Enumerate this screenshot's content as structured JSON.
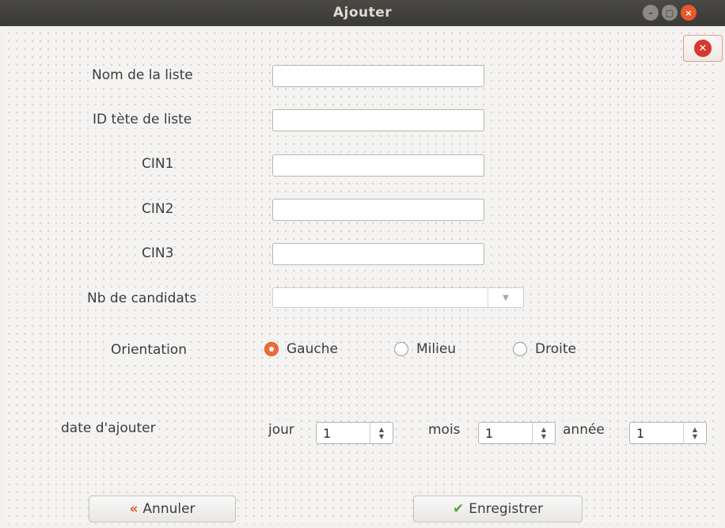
{
  "window": {
    "title": "Ajouter"
  },
  "form": {
    "nom_label": "Nom de la liste",
    "id_label": "ID tète de liste",
    "cin1_label": "CIN1",
    "cin2_label": "CIN2",
    "cin3_label": "CIN3",
    "nb_label": "Nb de candidats",
    "nom_value": "",
    "id_value": "",
    "cin1_value": "",
    "cin2_value": "",
    "cin3_value": "",
    "nb_selected": ""
  },
  "orientation": {
    "label": "Orientation",
    "options": [
      "Gauche",
      "Milieu",
      "Droite"
    ],
    "selected": "Gauche"
  },
  "date": {
    "label": "date d'ajouter",
    "jour_label": "jour",
    "jour_value": "1",
    "mois_label": "mois",
    "mois_value": "1",
    "annee_label": "année",
    "annee_value": "1"
  },
  "buttons": {
    "cancel": "Annuler",
    "save": "Enregistrer"
  },
  "icons": {
    "cancel": "chevrons-left-icon",
    "save": "checkmark-icon",
    "close": "close-circle-icon"
  },
  "colors": {
    "accent": "#ee6a37",
    "close": "#d9362f",
    "save_check": "#4fa830",
    "cancel_icon": "#e0562a"
  }
}
